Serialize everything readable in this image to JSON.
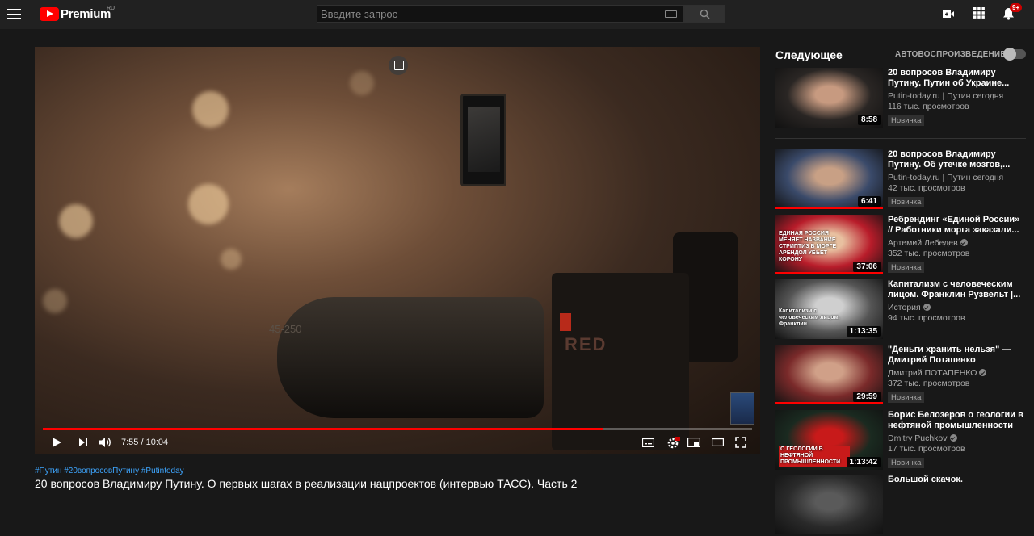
{
  "header": {
    "logo_text": "Premium",
    "region": "RU",
    "search_placeholder": "Введите запрос",
    "notification_count": "9+"
  },
  "player": {
    "current_time": "7:55",
    "duration": "10:04",
    "time_display": "7:55 / 10:04",
    "progress_fraction": 0.79,
    "lens_text": "45-250",
    "brand_text": "RED"
  },
  "video": {
    "hashtags": "#Путин #20вопросовПутину #Putintoday",
    "title": "20 вопросов Владимиру Путину. О первых шагах в реализации нацпроектов (интервью ТАСС). Часть 2"
  },
  "sidebar": {
    "up_next_label": "Следующее",
    "autoplay_label": "АВТОВОСПРОИЗВЕДЕНИЕ",
    "items": [
      {
        "title": "20 вопросов Владимиру Путину. Путин об Украине...",
        "channel": "Putin-today.ru | Путин сегодня",
        "verified": false,
        "views": "116 тыс. просмотров",
        "badge": "Новинка",
        "duration": "8:58",
        "watched": 0,
        "colors": [
          "#2a2624",
          "#c79a80"
        ]
      },
      {
        "title": "20 вопросов Владимиру Путину. Об утечке мозгов,...",
        "channel": "Putin-today.ru | Путин сегодня",
        "verified": false,
        "views": "42 тыс. просмотров",
        "badge": "Новинка",
        "duration": "6:41",
        "watched": 1,
        "colors": [
          "#3a4a6a",
          "#c8a085"
        ]
      },
      {
        "title": "Ребрендинг «Единой России» // Работники морга заказали...",
        "channel": "Артемий Лебедев",
        "verified": true,
        "views": "352 тыс. просмотров",
        "badge": "Новинка",
        "duration": "37:06",
        "watched": 1,
        "colors": [
          "#b81c2a",
          "#e8c0a0"
        ]
      },
      {
        "title": "Капитализм с человеческим лицом. Франклин Рузвельт |...",
        "channel": "История",
        "verified": true,
        "views": "94 тыс. просмотров",
        "badge": "",
        "duration": "1:13:35",
        "watched": 0,
        "colors": [
          "#555555",
          "#cfcfcf"
        ]
      },
      {
        "title": "\"Деньги хранить нельзя\" — Дмитрий Потапенко",
        "channel": "Дмитрий ПОТАПЕНКО",
        "verified": true,
        "views": "372 тыс. просмотров",
        "badge": "Новинка",
        "duration": "29:59",
        "watched": 1,
        "colors": [
          "#7a2a2a",
          "#d0a088"
        ]
      },
      {
        "title": "Борис Белозеров о геологии в нефтяной промышленности",
        "channel": "Dmitry Puchkov",
        "verified": true,
        "views": "17 тыс. просмотров",
        "badge": "Новинка",
        "duration": "1:13:42",
        "watched": 0,
        "colors": [
          "#1a2a20",
          "#c81a1a"
        ]
      },
      {
        "title": "Большой скачок.",
        "channel": "",
        "verified": false,
        "views": "",
        "badge": "",
        "duration": "",
        "watched": 0,
        "colors": [
          "#2a2a2a",
          "#5a5a5a"
        ]
      }
    ]
  },
  "thumb_texts": {
    "item2": "ЕДИНАЯ РОССИЯ МЕНЯЕТ НАЗВАНИЕ СТРИПТИЗ В МОРГЕ АРЕНДОЛ УБЬЕТ КОРОНУ",
    "item3": "Капитализм с человеческим лицом. Франклин",
    "item5": "О ГЕОЛОГИИ В НЕФТЯНОЙ ПРОМЫШЛЕННОСТИ"
  }
}
